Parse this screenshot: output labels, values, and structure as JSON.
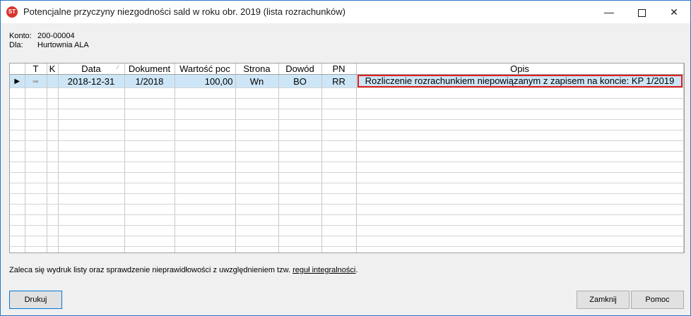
{
  "window": {
    "title": "Potencjalne przyczyny niezgodności sald w roku obr. 2019 (lista rozrachunków)",
    "icon": "app-icon",
    "minimize_label": "—",
    "close_label": "✕"
  },
  "account": {
    "konto_label": "Konto:",
    "konto_value": "200-00004",
    "dla_label": "Dla:",
    "dla_value": "Hurtownia ALA"
  },
  "grid": {
    "columns": [
      "",
      "T",
      "K",
      "Data",
      "Dokument",
      "Wartość poc",
      "Strona",
      "Dowód",
      "PN",
      "Opis"
    ],
    "rows": [
      {
        "selected": true,
        "indicator": "▶",
        "t": "➡",
        "k": "",
        "data": "2018-12-31",
        "dokument": "1/2018",
        "wartosc": "100,00",
        "strona": "Wn",
        "dowod": "BO",
        "pn": "RR",
        "opis": "Rozliczenie rozrachunkiem niepowiązanym z zapisem na koncie: KP 1/2019"
      }
    ],
    "empty_rows": 16,
    "colors": {
      "selected_row": "#cde6f7",
      "highlight_border": "#e02020",
      "accent": "#0078d7"
    }
  },
  "footer": {
    "note_text": "Zaleca się wydruk listy oraz sprawdzenie nieprawidłowości z uwzględnieniem tzw.",
    "note_link": "reguł integralności",
    "note_end": "."
  },
  "buttons": {
    "print": "Drukuj",
    "close": "Zamknij",
    "help": "Pomoc"
  }
}
